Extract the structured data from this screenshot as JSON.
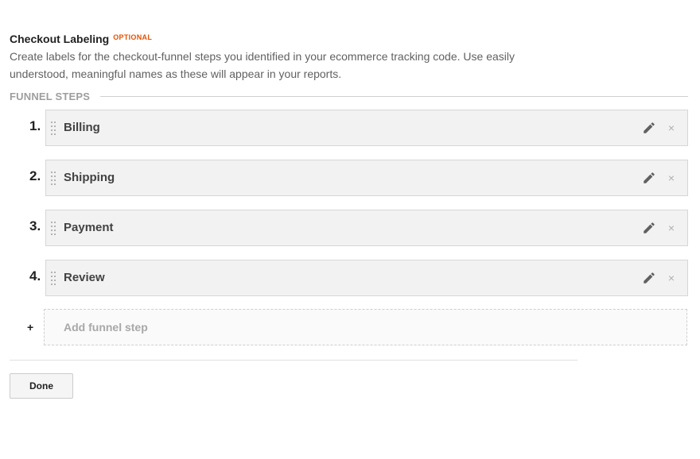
{
  "section": {
    "title": "Checkout Labeling",
    "optional_label": "OPTIONAL",
    "description": "Create labels for the checkout-funnel steps you identified in your ecommerce tracking code. Use easily understood, meaningful names as these will appear in your reports."
  },
  "funnel": {
    "header": "FUNNEL STEPS",
    "steps": [
      {
        "number": "1.",
        "name": "Billing",
        "edit_icon": "pencil-icon",
        "remove_icon": "close-icon",
        "remove_glyph": "×"
      },
      {
        "number": "2.",
        "name": "Shipping",
        "edit_icon": "pencil-icon",
        "remove_icon": "close-icon",
        "remove_glyph": "×"
      },
      {
        "number": "3.",
        "name": "Payment",
        "edit_icon": "pencil-icon",
        "remove_icon": "close-icon",
        "remove_glyph": "×"
      },
      {
        "number": "4.",
        "name": "Review",
        "edit_icon": "pencil-icon",
        "remove_icon": "close-icon",
        "remove_glyph": "×"
      }
    ],
    "add_step": {
      "plus": "+",
      "label": "Add funnel step"
    }
  },
  "actions": {
    "done_label": "Done"
  },
  "colors": {
    "optional": "#e65100",
    "step_bg": "#f2f2f2",
    "step_border": "#d6d6d6",
    "muted_text": "#9e9e9e"
  }
}
